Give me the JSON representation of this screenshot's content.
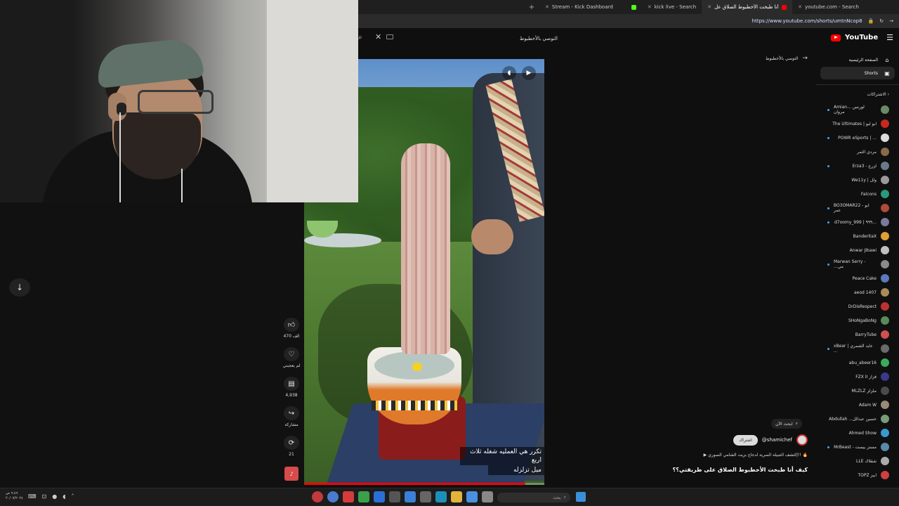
{
  "browser": {
    "tabs": [
      {
        "label": "Stream - Kick Dashboard",
        "color": "#53fc18"
      },
      {
        "label": "kick live - Search",
        "color": "#3ea6ff"
      },
      {
        "label": "كيف أنا طبخت الأخطبوط الصلاق عل",
        "color": "#ff0000"
      },
      {
        "label": "youtube.com - Search",
        "color": "#3ea6ff"
      }
    ],
    "new_tab": "+",
    "url": "https://www.youtube.com/shorts/umtnNcop8"
  },
  "youtube": {
    "logo": "YouTube",
    "search_value": "التوصي بالأخطبوط",
    "nav": [
      {
        "label": "الصفحة الرئيسية",
        "icon": "home-icon"
      },
      {
        "label": "Shorts",
        "icon": "shorts-icon"
      }
    ],
    "back_label": "التوصي بالأخطبوط",
    "subscriptions_header": "الاشتراكات",
    "subscriptions": [
      {
        "name": "Amian... لورنس مروان",
        "dot": true,
        "color": "#6a8a6a"
      },
      {
        "name": "The Ultimates | ابو لبو",
        "dot": false,
        "color": "#c8281e"
      },
      {
        "name": "POWR eSports | ...",
        "dot": true,
        "color": "#dddddd"
      },
      {
        "name": "مردي الثمر",
        "dot": false,
        "color": "#8a6a4a"
      },
      {
        "name": "Erza3 - لزرع",
        "dot": true,
        "color": "#6a7a8a"
      },
      {
        "name": "We11y | ولل",
        "dot": false,
        "color": "#9a9a9a"
      },
      {
        "name": "Falcons",
        "dot": false,
        "color": "#2a9a7a"
      },
      {
        "name": "BO3OMAR22 - ابو عمر",
        "dot": true,
        "color": "#b04a3a"
      },
      {
        "name": "d7oomy_999 | ٩٩٩...",
        "dot": true,
        "color": "#7a7a9a"
      },
      {
        "name": "BanderitaX",
        "dot": false,
        "color": "#e0a030"
      },
      {
        "name": "Anwar Jibawi",
        "dot": false,
        "color": "#c0c0c0"
      },
      {
        "name": "Marwan Serry - ...مي",
        "dot": true,
        "color": "#8a8a8a"
      },
      {
        "name": "Peace Cake",
        "dot": false,
        "color": "#5a7aba"
      },
      {
        "name": "aeod 1407",
        "dot": false,
        "color": "#aa8a5a"
      },
      {
        "name": "DrDisRespect",
        "dot": false,
        "color": "#c03030"
      },
      {
        "name": "SHoNgaBoNg",
        "dot": false,
        "color": "#5a8a5a"
      },
      {
        "name": "BarryTube",
        "dot": false,
        "color": "#d05050"
      },
      {
        "name": "xBear | عايد الشمري ...",
        "dot": true,
        "color": "#6a6a6a"
      },
      {
        "name": "abu_abeer16",
        "dot": false,
        "color": "#3aaa5a"
      },
      {
        "name": "FZX II فزاز",
        "dot": false,
        "color": "#3a3a8a"
      },
      {
        "name": "MLZLZ ملزلز",
        "dot": false,
        "color": "#4a4a4a"
      },
      {
        "name": "Adam W",
        "dot": false,
        "color": "#9a8a7a"
      },
      {
        "name": "Abdullah ...حسين عبدالل",
        "dot": false,
        "color": "#7a9a7a"
      },
      {
        "name": "Ahmed Show",
        "dot": false,
        "color": "#3a9ad0"
      },
      {
        "name": "MrBeast - مستر بيست",
        "dot": true,
        "color": "#5a8aaa"
      },
      {
        "name": "LLE شقلاك",
        "dot": false,
        "color": "#aaaaaa"
      },
      {
        "name": "TOPZ ابيز",
        "dot": false,
        "color": "#d04040"
      }
    ]
  },
  "short": {
    "caption_line1": "تكرر هي العمليه شغله ثلاث اربع",
    "caption_line2": "ميل تزلزله",
    "progress": 0.92,
    "actions": [
      {
        "icon": "like-icon",
        "label": "470 الف"
      },
      {
        "icon": "dislike-icon",
        "label": "لم يعجبني"
      },
      {
        "icon": "comment-icon",
        "label": "4,938"
      },
      {
        "icon": "share-icon",
        "label": "مشاركة"
      },
      {
        "icon": "remix-icon",
        "label": "21"
      }
    ],
    "search_chip": "ابحث الآن",
    "channel": "@shamichef",
    "subscribe": "اشتراك",
    "description": "▶ إكتشف التتبيلة السرية لدجاج بزيت الشامي السوري!! 🔥",
    "title": "كيف أنا طبخت الأخطبوط الصلاق على طريقتي؟؟"
  },
  "taskbar": {
    "clock_line1": "٩:٤٩ ص",
    "clock_line2": "٢٠/٠٧/٢٠٢٤",
    "search_label": "بحث"
  }
}
